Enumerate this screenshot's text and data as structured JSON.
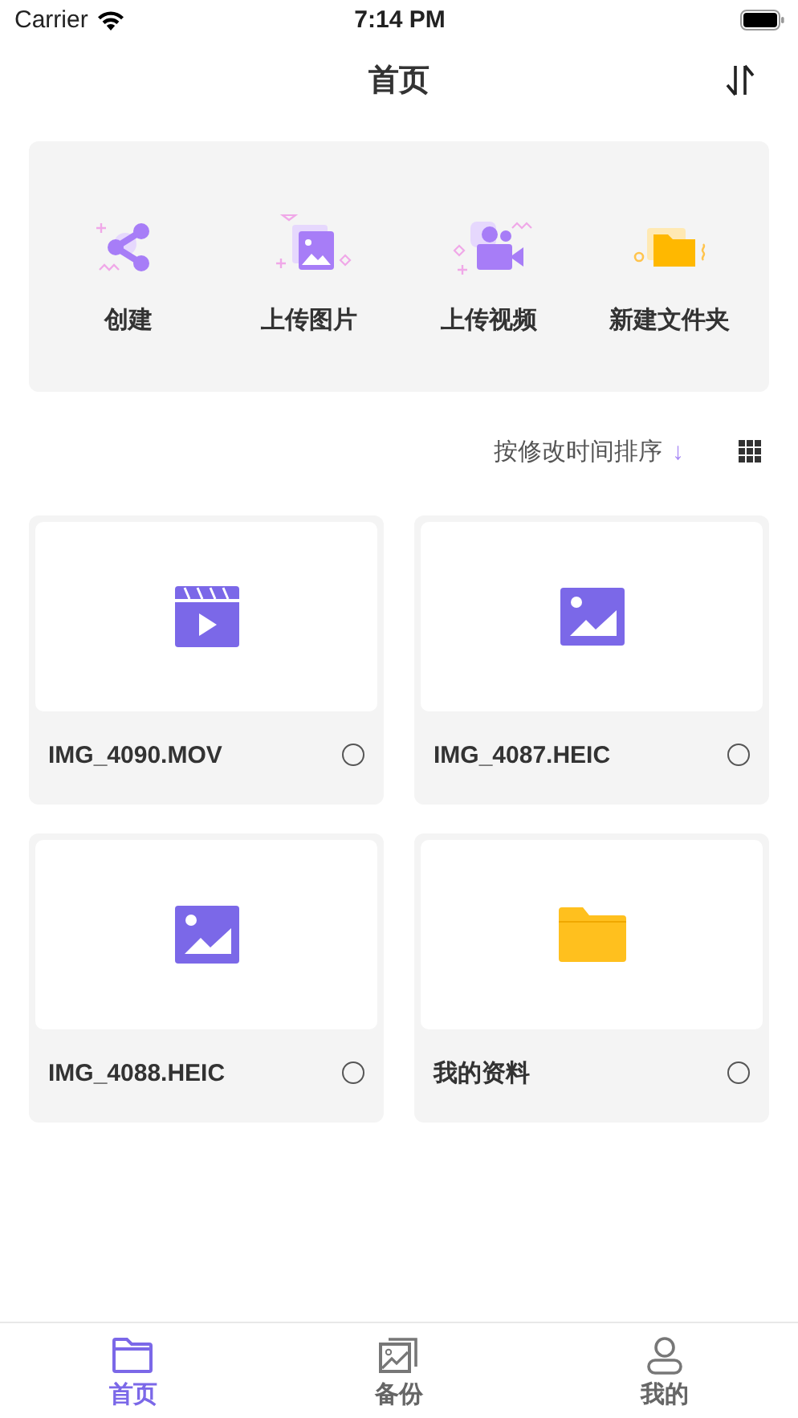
{
  "status_bar": {
    "carrier": "Carrier",
    "time": "7:14 PM"
  },
  "nav": {
    "title": "首页"
  },
  "actions": [
    {
      "kind": "share",
      "label": "创建"
    },
    {
      "kind": "image",
      "label": "上传图片"
    },
    {
      "kind": "video",
      "label": "上传视频"
    },
    {
      "kind": "folder",
      "label": "新建文件夹"
    }
  ],
  "sort": {
    "label": "按修改时间排序",
    "arrow": "↓"
  },
  "files": [
    {
      "kind": "video",
      "name": "IMG_4090.MOV",
      "selected": false
    },
    {
      "kind": "image",
      "name": "IMG_4087.HEIC",
      "selected": false
    },
    {
      "kind": "image",
      "name": "IMG_4088.HEIC",
      "selected": false
    },
    {
      "kind": "folder",
      "name": "我的资料",
      "selected": false
    }
  ],
  "tabs": [
    {
      "kind": "folder",
      "label": "首页",
      "selected": true
    },
    {
      "kind": "gallery",
      "label": "备份",
      "selected": false
    },
    {
      "kind": "person",
      "label": "我的",
      "selected": false
    }
  ]
}
